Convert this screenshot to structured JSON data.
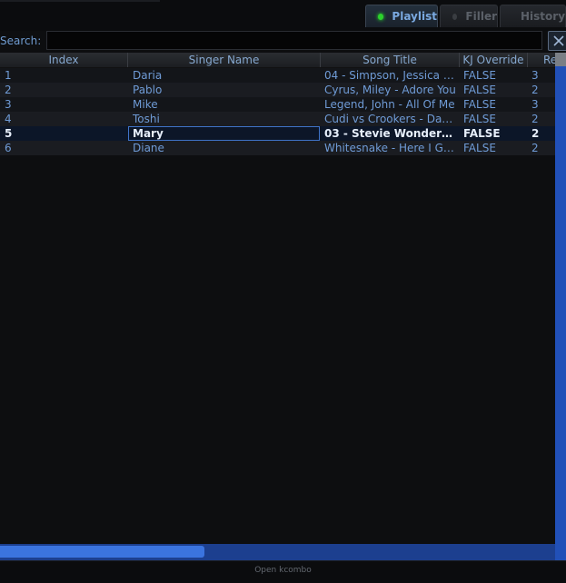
{
  "tabs": [
    {
      "label": "Playlist",
      "active": true
    },
    {
      "label": "Filler",
      "active": false
    },
    {
      "label": "History",
      "active": false
    }
  ],
  "search": {
    "label": "Search:",
    "value": "",
    "placeholder": ""
  },
  "table": {
    "columns": [
      "Index",
      "Singer Name",
      "Song Title",
      "KJ Override",
      "Re"
    ],
    "rows": [
      {
        "index": "1",
        "singer": "Daria",
        "song": "04 - Simpson, Jessica - ...",
        "kj": "FALSE",
        "re": "3"
      },
      {
        "index": "2",
        "singer": "Pablo",
        "song": "Cyrus, Miley - Adore You",
        "kj": "FALSE",
        "re": "2"
      },
      {
        "index": "3",
        "singer": "Mike",
        "song": "Legend, John - All Of Me",
        "kj": "FALSE",
        "re": "3"
      },
      {
        "index": "4",
        "singer": "Toshi",
        "song": "Cudi vs Crookers - Day ...",
        "kj": "FALSE",
        "re": "2"
      },
      {
        "index": "5",
        "singer": "Mary",
        "song": "03 - Stevie Wonder - Si...",
        "kj": "FALSE",
        "re": "2",
        "selected": true
      },
      {
        "index": "6",
        "singer": "Diane",
        "song": "Whitesnake - Here I Go ...",
        "kj": "FALSE",
        "re": "2"
      }
    ]
  },
  "status": {
    "text": "Open kcombo"
  },
  "colors": {
    "accent": "#3b74df",
    "led_active": "#2cd12c",
    "scroll_track": "#2150b8"
  },
  "icons": {
    "clear": "close-icon",
    "tab_indicator": "led-dot"
  }
}
